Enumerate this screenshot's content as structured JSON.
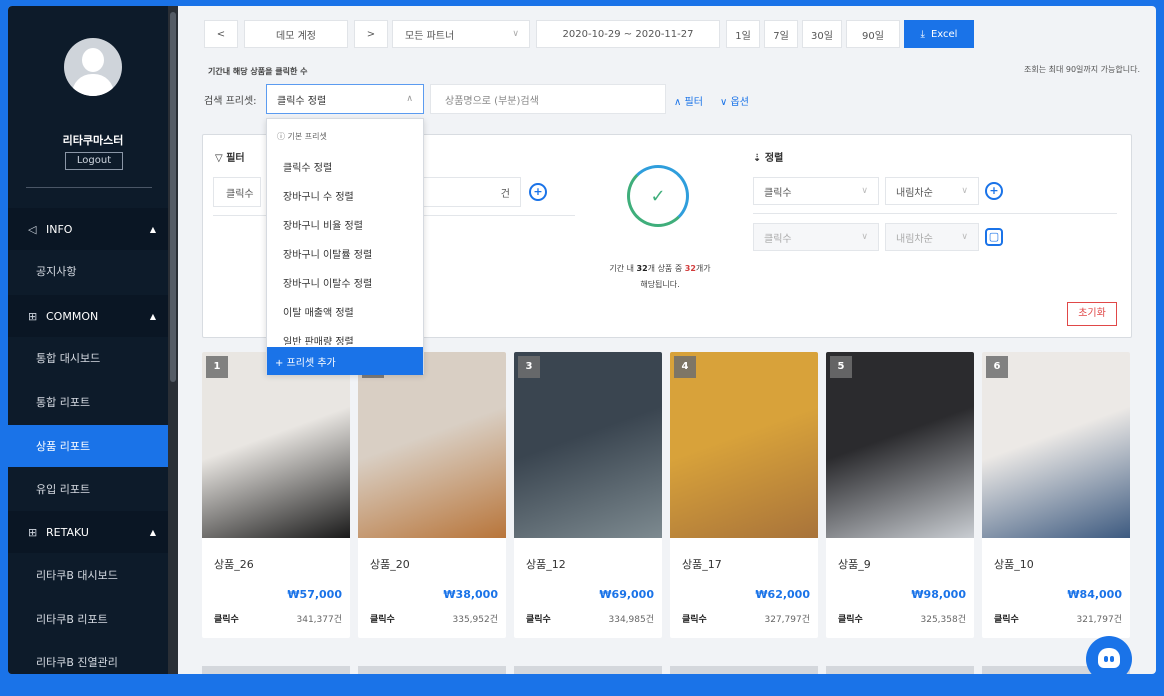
{
  "colors": {
    "accent": "#1a73e8",
    "sidebar_bg": "#0d1b2a",
    "danger": "#e04848",
    "success": "#3fae7b"
  },
  "sidebar": {
    "user_name": "리타쿠마스터",
    "logout_label": "Logout",
    "sections": [
      {
        "label": "INFO",
        "icon": "megaphone-icon",
        "items": [
          "공지사항"
        ]
      },
      {
        "label": "COMMON",
        "icon": "grid-icon",
        "items": [
          "통합 대시보드",
          "통합 리포트",
          "상품 리포트",
          "유입 리포트"
        ]
      },
      {
        "label": "RETAKU",
        "icon": "grid-icon",
        "items": [
          "리타쿠B 대시보드",
          "리타쿠B 리포트",
          "리타쿠B 진열관리"
        ]
      }
    ],
    "active_item": "상품 리포트"
  },
  "toolbar": {
    "prev": "<",
    "account": "데모 계정",
    "next": ">",
    "partner": "모든 파트너",
    "date_range": "2020-10-29  ~  2020-11-27",
    "ranges": [
      "1일",
      "7일",
      "30일",
      "90일"
    ],
    "excel": "Excel"
  },
  "subtitle": "기간내 해당 상품을 클릭한 수",
  "note": "조회는 최대 90일까지 가능합니다.",
  "preset": {
    "label": "검색 프리셋:",
    "selected": "클릭수 정렬",
    "search_placeholder": "상품명으로 (부분)검색",
    "filter_link": "필터",
    "option_link": "옵션"
  },
  "dropdown": {
    "header": "기본 프리셋",
    "items": [
      "클릭수 정렬",
      "장바구니 수 정렬",
      "장바구니 비율 정렬",
      "장바구니 이탈률 정렬",
      "장바구니 이탈수 정렬",
      "이탈 매출액 정렬",
      "일반 판매량 정렬"
    ],
    "add_label": "+ 프리셋 추가"
  },
  "filter": {
    "title": "필터",
    "field": "클릭수",
    "unit": "건"
  },
  "match": {
    "prefix": "기간 내 ",
    "total": "32",
    "mid": "개 상품 중 ",
    "matched": "32",
    "suffix": "개가",
    "line2": "해당됩니다."
  },
  "sort": {
    "title": "정렬",
    "rows": [
      {
        "field": "클릭수",
        "order": "내림차순"
      },
      {
        "field": "클릭수",
        "order": "내림차순"
      }
    ],
    "reset": "초기화"
  },
  "products": [
    {
      "rank": "1",
      "name": "상품_26",
      "price": "₩57,000",
      "click_label": "클릭수",
      "clicks": "341,377건",
      "palette": [
        "#e9e6e2",
        "#1a1a1a"
      ]
    },
    {
      "rank": "2",
      "name": "상품_20",
      "price": "₩38,000",
      "click_label": "클릭수",
      "clicks": "335,952건",
      "palette": [
        "#d9cfc4",
        "#b8753a"
      ]
    },
    {
      "rank": "3",
      "name": "상품_12",
      "price": "₩69,000",
      "click_label": "클릭수",
      "clicks": "334,985건",
      "palette": [
        "#3a4550",
        "#7d8a90"
      ]
    },
    {
      "rank": "4",
      "name": "상품_17",
      "price": "₩62,000",
      "click_label": "클릭수",
      "clicks": "327,797건",
      "palette": [
        "#d8a23a",
        "#a8733a"
      ]
    },
    {
      "rank": "5",
      "name": "상품_9",
      "price": "₩98,000",
      "click_label": "클릭수",
      "clicks": "325,358건",
      "palette": [
        "#2b2b2e",
        "#c9cdd2"
      ]
    },
    {
      "rank": "6",
      "name": "상품_10",
      "price": "₩84,000",
      "click_label": "클릭수",
      "clicks": "321,797건",
      "palette": [
        "#ece9e6",
        "#3d5a80"
      ]
    }
  ]
}
